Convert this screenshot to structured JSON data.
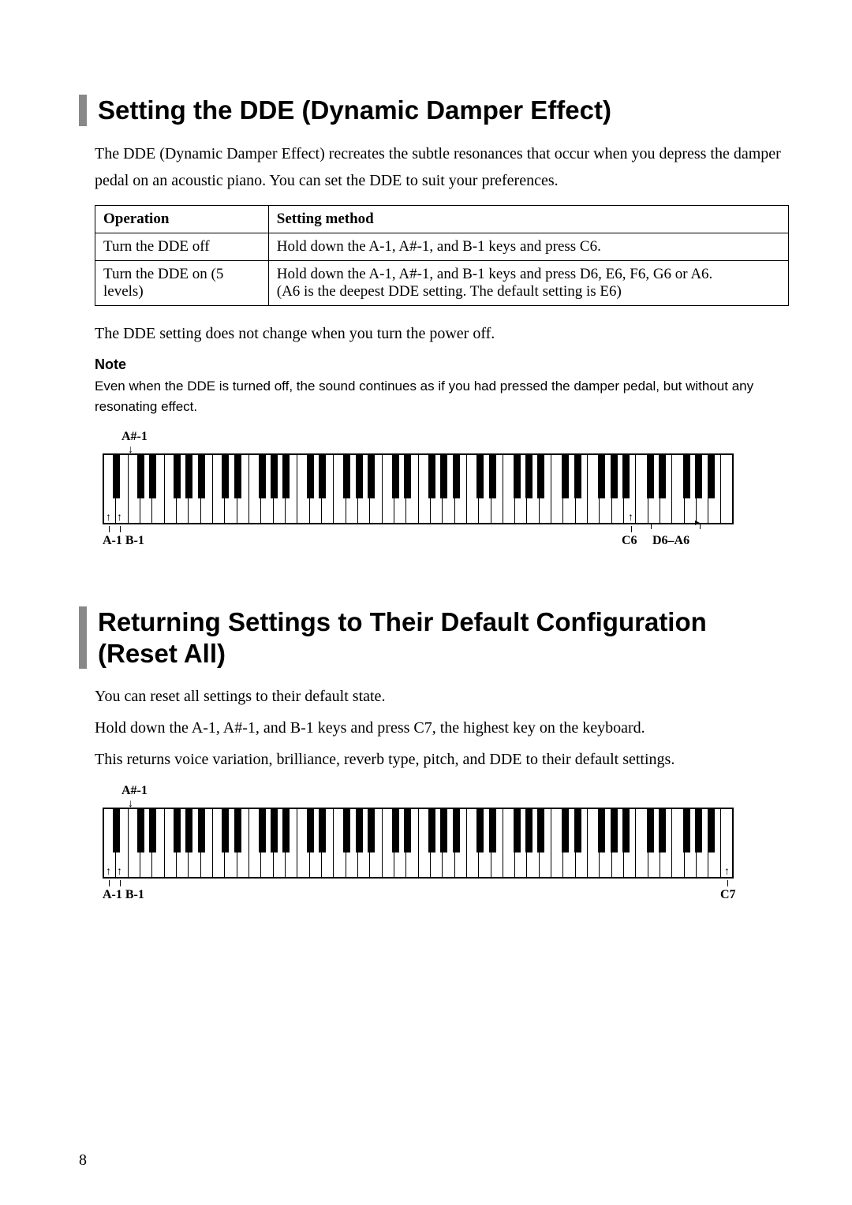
{
  "section1": {
    "heading": "Setting the DDE (Dynamic Damper Effect)",
    "intro": "The DDE (Dynamic Damper Effect) recreates the subtle resonances that occur when you depress the damper pedal on an acoustic piano. You can set the DDE to suit your preferences.",
    "table": {
      "headers": [
        "Operation",
        "Setting method"
      ],
      "rows": [
        [
          "Turn the DDE off",
          "Hold down the A-1, A#-1, and B-1 keys and press C6."
        ],
        [
          "Turn the DDE on (5 levels)",
          "Hold down the A-1, A#-1, and B-1 keys and press D6, E6, F6, G6 or A6.\n(A6 is the deepest DDE setting. The default setting is E6)"
        ]
      ]
    },
    "after_table": "The DDE setting does not change when you turn the power off.",
    "note_heading": "Note",
    "note_body": "Even when the DDE is turned off, the sound continues as if you had pressed the damper pedal, but without any resonating effect.",
    "kbd_labels": {
      "top": "A#-1",
      "bot_left": "A-1 B-1",
      "bot_right_a": "C6",
      "bot_right_b": "D6–A6"
    }
  },
  "section2": {
    "heading": "Returning Settings to Their Default Configuration (Reset All)",
    "p1": "You can reset all settings to their default state.",
    "p2": "Hold down the A-1, A#-1, and B-1 keys and press C7, the highest key on the keyboard.",
    "p3": "This returns voice variation, brilliance, reverb type, pitch, and DDE to their default settings.",
    "kbd_labels": {
      "top": "A#-1",
      "bot_left": "A-1 B-1",
      "bot_right": "C7"
    }
  },
  "page_number": "8"
}
